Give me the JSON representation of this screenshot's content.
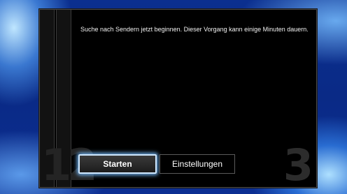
{
  "dialog": {
    "message": "Suche nach Sendern jetzt beginnen. Dieser Vorgang kann einige Minuten dauern.",
    "step_left": "12",
    "step_right": "3"
  },
  "buttons": {
    "start_label": "Starten",
    "settings_label": "Einstellungen"
  }
}
